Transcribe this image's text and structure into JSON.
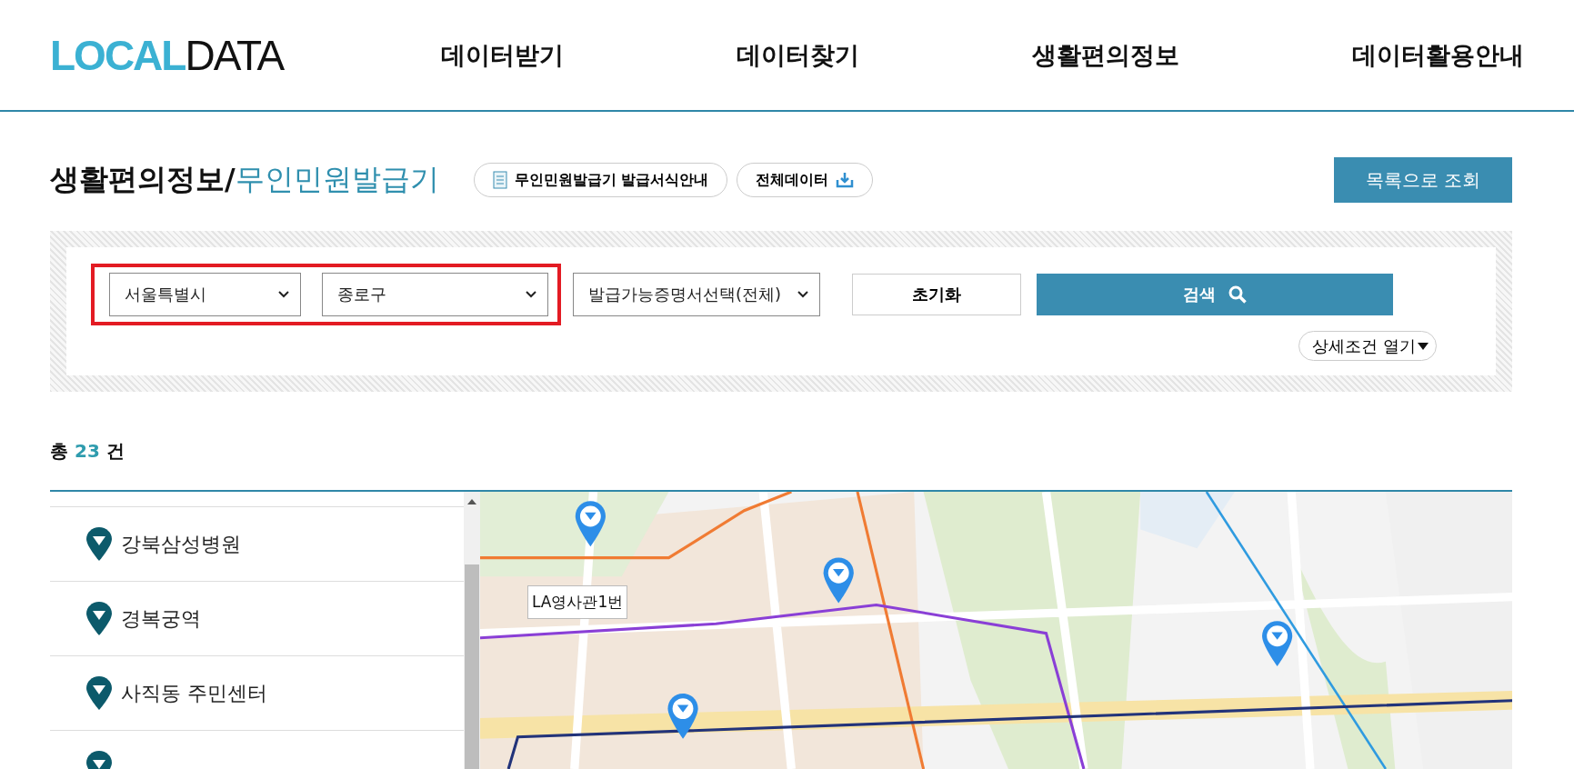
{
  "header": {
    "logo": {
      "accent": "LOCAL",
      "rest": "DATA"
    },
    "nav": [
      "데이터받기",
      "데이터찾기",
      "생활편의정보",
      "데이터활용안내"
    ]
  },
  "page_title": {
    "section": "생활편의정보",
    "separator": "/",
    "current": "무인민원발급기"
  },
  "title_buttons": [
    {
      "label": "무인민원발급기 발급서식안내",
      "kind": "document"
    },
    {
      "label": "전체데이터",
      "kind": "download"
    }
  ],
  "list_button": "목록으로 조회",
  "filters": {
    "highlighted": true,
    "region_selects": [
      "서울특별시",
      "종로구"
    ],
    "certificate_select": "발급가능증명서선택(전체)",
    "reset": "초기화",
    "search": "검색",
    "details": "상세조건 열기"
  },
  "result": {
    "prefix": "총",
    "count": "23",
    "suffix": "건"
  },
  "places": [
    {
      "name": "강북삼성병원"
    },
    {
      "name": "경복궁역"
    },
    {
      "name": "사직동 주민센터"
    }
  ],
  "map": {
    "kind": "picture",
    "popup": "LA영사관1번"
  }
}
